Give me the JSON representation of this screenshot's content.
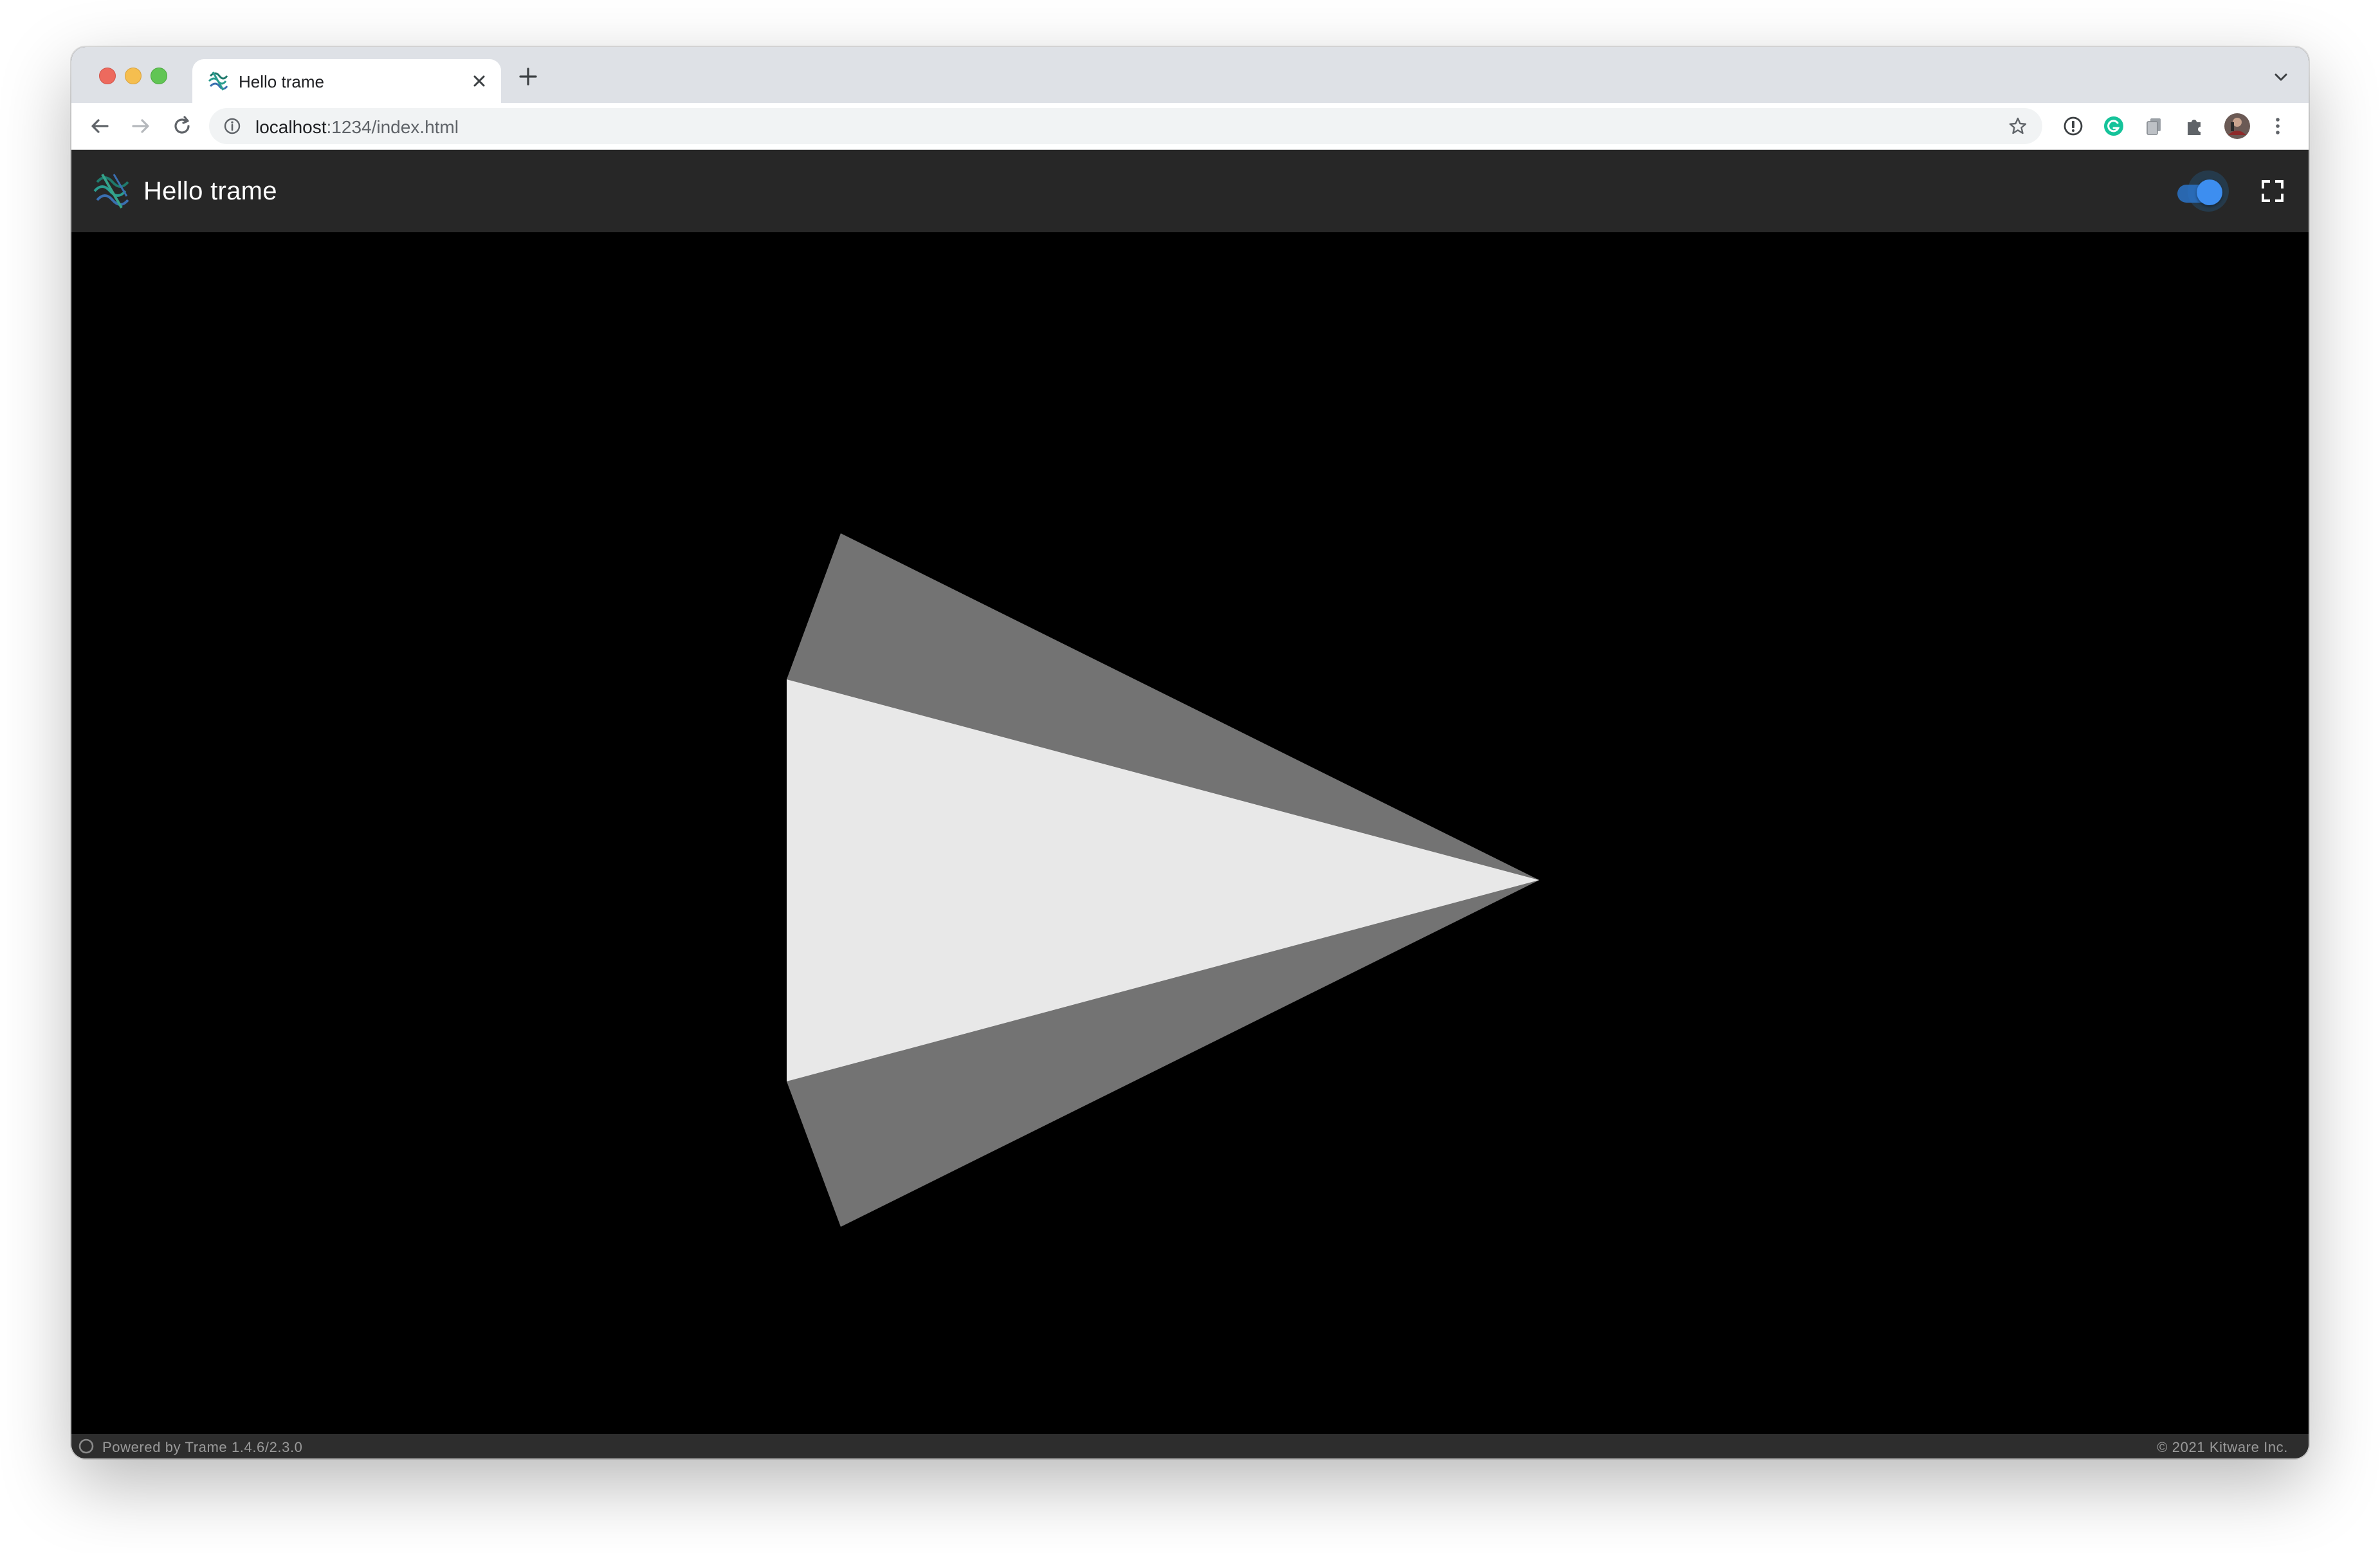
{
  "browser": {
    "tab": {
      "title": "Hello trame",
      "favicon_icon": "trame-logo-icon",
      "close_icon": "close-icon"
    },
    "new_tab_icon": "plus-icon",
    "tab_menu_icon": "chevron-down-icon",
    "toolbar": {
      "back_icon": "arrow-left-icon",
      "forward_icon": "arrow-right-icon",
      "reload_icon": "reload-icon",
      "info_icon": "info-icon",
      "bookmark_icon": "star-icon"
    },
    "address": {
      "host": "localhost",
      "path": ":1234/index.html"
    },
    "extensions": [
      {
        "icon": "password-manager-icon"
      },
      {
        "icon": "grammarly-icon",
        "color": "#15c39a"
      },
      {
        "icon": "copy-extension-icon"
      },
      {
        "icon": "puzzle-piece-icon"
      },
      {
        "icon": "profile-avatar-icon"
      },
      {
        "icon": "more-vertical-icon"
      }
    ]
  },
  "app": {
    "title": "Hello trame",
    "logo_icon": "trame-logo-icon",
    "theme_toggle": {
      "icon": "toggle-switch-icon",
      "on": true,
      "color": "#3d8ef0"
    },
    "fullscreen_icon": "fullscreen-icon"
  },
  "viewport": {
    "background": "#000000",
    "shape": "cone",
    "face_colors": {
      "lit": "#e8e8e8",
      "shaded": "#737373"
    }
  },
  "footer": {
    "powered_by": "Powered by Trame 1.4.6/2.3.0",
    "copyright": "© 2021 Kitware Inc."
  }
}
